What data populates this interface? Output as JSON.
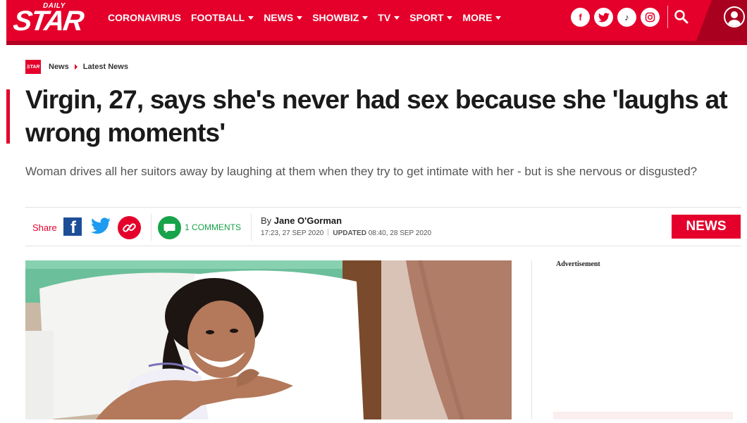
{
  "brand": {
    "logo_small": "DAILY",
    "logo_main": "STAR",
    "mini_logo": "STAR",
    "accent_color": "#e4002b"
  },
  "nav": {
    "items": [
      {
        "label": "CORONAVIRUS",
        "dropdown": false
      },
      {
        "label": "FOOTBALL",
        "dropdown": true
      },
      {
        "label": "NEWS",
        "dropdown": true
      },
      {
        "label": "SHOWBIZ",
        "dropdown": true
      },
      {
        "label": "TV",
        "dropdown": true
      },
      {
        "label": "SPORT",
        "dropdown": true
      },
      {
        "label": "MORE",
        "dropdown": true
      }
    ],
    "social": [
      {
        "name": "facebook-icon",
        "glyph": "f"
      },
      {
        "name": "twitter-icon",
        "glyph": ""
      },
      {
        "name": "tiktok-icon",
        "glyph": "♪"
      },
      {
        "name": "instagram-icon",
        "glyph": ""
      }
    ],
    "search_icon": "search-icon",
    "account_icon": "user-icon"
  },
  "breadcrumb": {
    "items": [
      "News",
      "Latest News"
    ]
  },
  "article": {
    "headline": "Virgin, 27, says she's never had sex because she 'laughs at wrong moments'",
    "standfirst": "Woman drives all her suitors away by laughing at them when they try to get intimate with her - but is she nervous or disgusted?",
    "share_label": "Share",
    "comments_count": "1",
    "comments_label": "COMMENTS",
    "by_prefix": "By",
    "author": "Jane O'Gorman",
    "published": "17:23, 27 SEP 2020",
    "updated_label": "UPDATED",
    "updated": "08:40, 28 SEP 2020",
    "section_tag": "NEWS"
  },
  "sidebar": {
    "ad_label": "Advertisement"
  }
}
